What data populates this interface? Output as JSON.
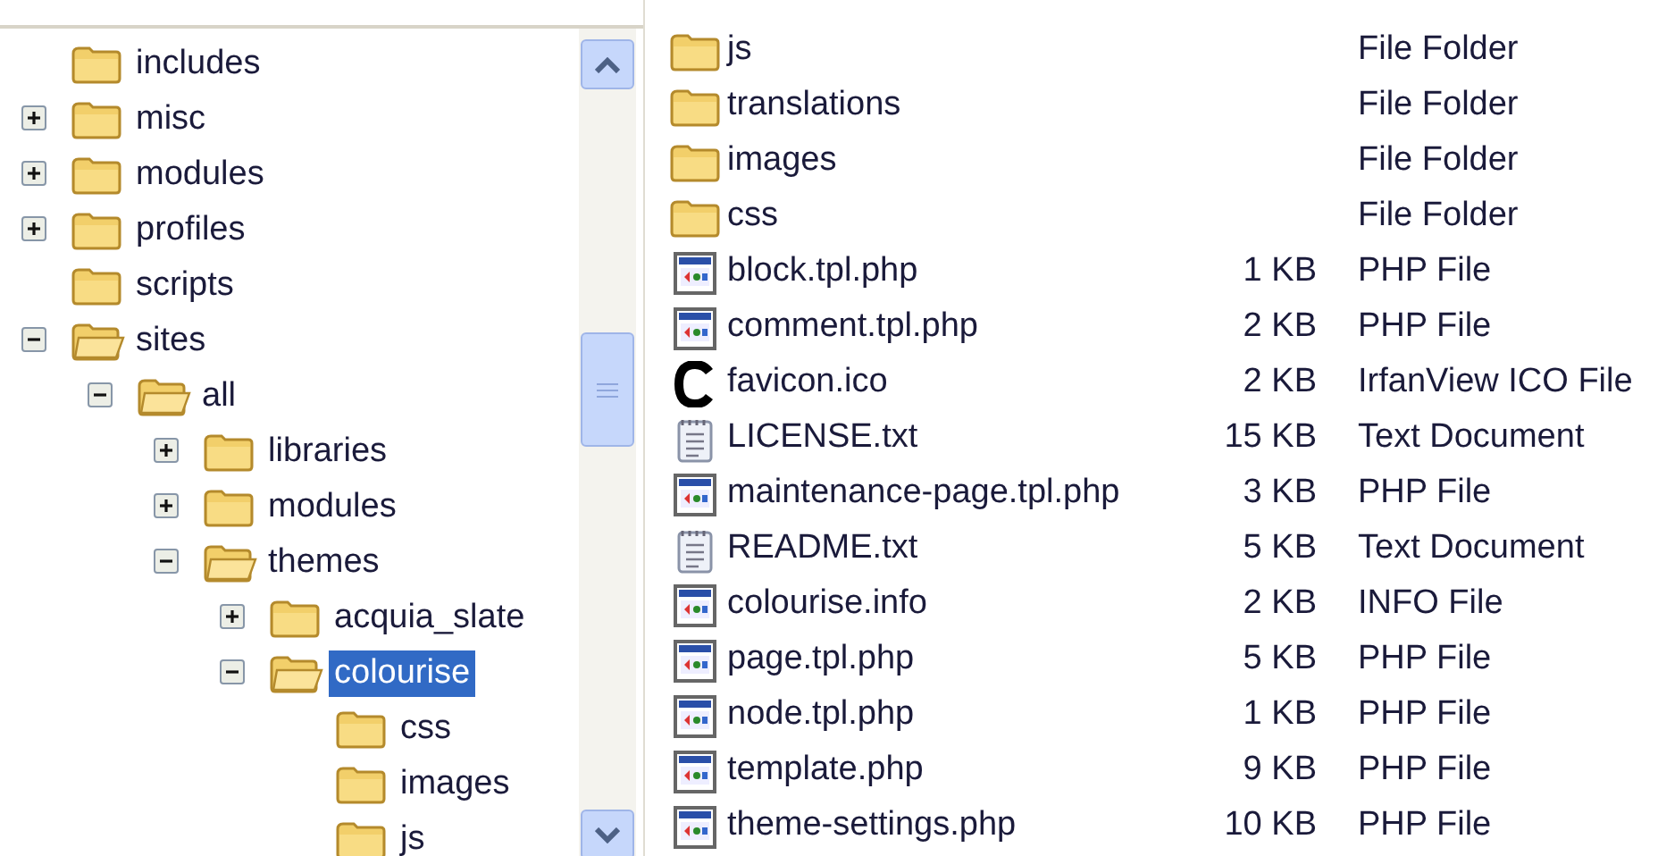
{
  "tree": [
    {
      "label": "includes",
      "selected": false
    },
    {
      "label": "misc",
      "expanded": false,
      "selected": false
    },
    {
      "label": "modules",
      "expanded": false,
      "selected": false
    },
    {
      "label": "profiles",
      "expanded": false,
      "selected": false
    },
    {
      "label": "scripts",
      "selected": false
    },
    {
      "label": "sites",
      "expanded": true,
      "selected": false,
      "children": [
        {
          "label": "all",
          "expanded": true,
          "selected": false,
          "children": [
            {
              "label": "libraries",
              "expanded": false,
              "selected": false
            },
            {
              "label": "modules",
              "expanded": false,
              "selected": false
            },
            {
              "label": "themes",
              "expanded": true,
              "selected": false,
              "children": [
                {
                  "label": "acquia_slate",
                  "expanded": false,
                  "selected": false
                },
                {
                  "label": "colourise",
                  "expanded": true,
                  "selected": true,
                  "children": [
                    {
                      "label": "css",
                      "selected": false
                    },
                    {
                      "label": "images",
                      "selected": false
                    },
                    {
                      "label": "js",
                      "selected": false
                    }
                  ]
                }
              ]
            }
          ]
        }
      ]
    }
  ],
  "files": [
    {
      "name": "js",
      "kind": "folder",
      "type": "File Folder"
    },
    {
      "name": "translations",
      "kind": "folder",
      "type": "File Folder"
    },
    {
      "name": "images",
      "kind": "folder",
      "type": "File Folder"
    },
    {
      "name": "css",
      "kind": "folder",
      "type": "File Folder"
    },
    {
      "name": "block.tpl.php",
      "kind": "script",
      "size": "1 KB",
      "type": "PHP File"
    },
    {
      "name": "comment.tpl.php",
      "kind": "script",
      "size": "2 KB",
      "type": "PHP File"
    },
    {
      "name": "favicon.ico",
      "kind": "image",
      "size": "2 KB",
      "type": "IrfanView ICO File"
    },
    {
      "name": "LICENSE.txt",
      "kind": "text",
      "size": "15 KB",
      "type": "Text Document"
    },
    {
      "name": "maintenance-page.tpl.php",
      "kind": "script",
      "size": "3 KB",
      "type": "PHP File"
    },
    {
      "name": "README.txt",
      "kind": "text",
      "size": "5 KB",
      "type": "Text Document"
    },
    {
      "name": "colourise.info",
      "kind": "script",
      "size": "2 KB",
      "type": "INFO File"
    },
    {
      "name": "page.tpl.php",
      "kind": "script",
      "size": "5 KB",
      "type": "PHP File"
    },
    {
      "name": "node.tpl.php",
      "kind": "script",
      "size": "1 KB",
      "type": "PHP File"
    },
    {
      "name": "template.php",
      "kind": "script",
      "size": "9 KB",
      "type": "PHP File"
    },
    {
      "name": "theme-settings.php",
      "kind": "script",
      "size": "10 KB",
      "type": "PHP File"
    }
  ]
}
